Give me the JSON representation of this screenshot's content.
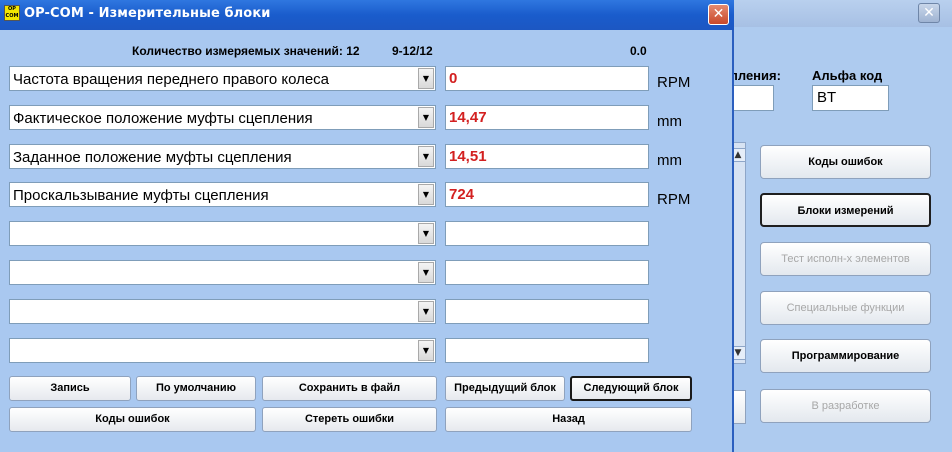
{
  "background_window": {
    "close_glyph": "✕",
    "partial_label_1": "пления:",
    "alpha_label": "Альфа код",
    "alpha_value": "BT",
    "buttons": [
      {
        "label": "Коды ошибок",
        "enabled": true
      },
      {
        "label": "Блоки измерений",
        "enabled": true,
        "active": true
      },
      {
        "label": "Тест исполн-х элементов",
        "enabled": false
      },
      {
        "label": "Специальные функции",
        "enabled": false
      },
      {
        "label": "Программирование",
        "enabled": true
      },
      {
        "label": "В разработке",
        "enabled": false
      }
    ]
  },
  "dialog": {
    "app_icon_text": "OP COM",
    "title": "OP-COM - Измерительные блоки",
    "close_glyph": "✕",
    "header": {
      "count_label": "Количество измеряемых значений: 12",
      "range": "9-12/12",
      "rate": "0.0"
    },
    "rows": [
      {
        "name": "Частота вращения переднего правого колеса",
        "value": "0",
        "unit": "RPM"
      },
      {
        "name": "Фактическое положение муфты сцепления",
        "value": "14,47",
        "unit": "mm"
      },
      {
        "name": "Заданное положение муфты сцепления",
        "value": "14,51",
        "unit": "mm"
      },
      {
        "name": "Проскальзывание муфты сцепления",
        "value": "724",
        "unit": "RPM"
      },
      {
        "name": "",
        "value": "",
        "unit": ""
      },
      {
        "name": "",
        "value": "",
        "unit": ""
      },
      {
        "name": "",
        "value": "",
        "unit": ""
      },
      {
        "name": "",
        "value": "",
        "unit": ""
      }
    ],
    "dropdown_arrow": "▼",
    "buttons": {
      "record": "Запись",
      "default": "По умолчанию",
      "save_file": "Сохранить в файл",
      "prev_block": "Предыдущий блок",
      "next_block": "Следующий блок",
      "error_codes": "Коды ошибок",
      "clear_errors": "Стереть ошибки",
      "back": "Назад"
    }
  },
  "colors": {
    "dialog_bg": "#a9c8f0",
    "titlebar": "#1a5ccc",
    "value_text": "#d32020"
  }
}
